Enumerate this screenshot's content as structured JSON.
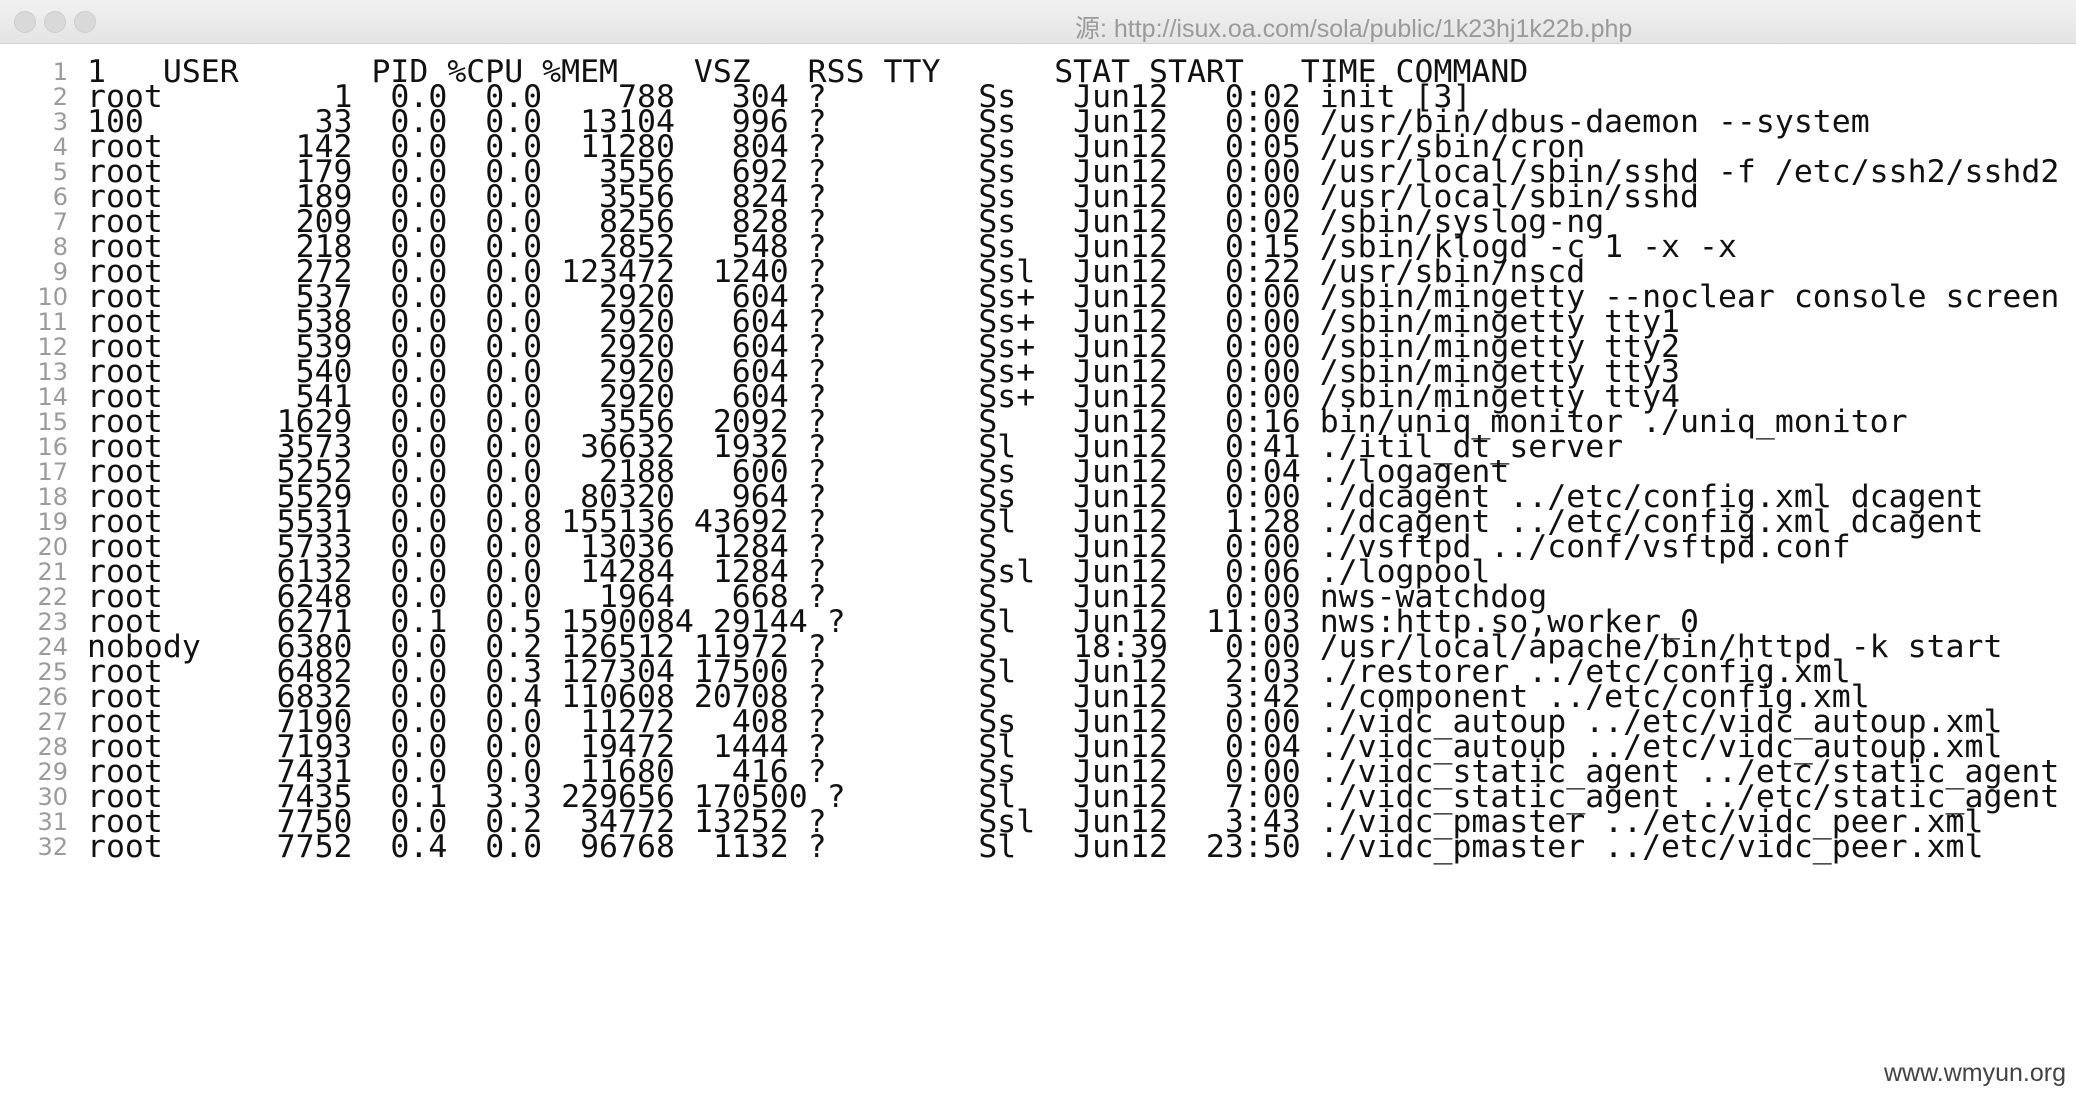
{
  "window": {
    "title": "源: http://isux.oa.com/sola/public/1k23hj1k22b.php"
  },
  "lines": [
    "1   USER       PID %CPU %MEM    VSZ   RSS TTY      STAT START   TIME COMMAND",
    "root         1  0.0  0.0    788   304 ?        Ss   Jun12   0:02 init [3]",
    "100         33  0.0  0.0  13104   996 ?        Ss   Jun12   0:00 /usr/bin/dbus-daemon --system",
    "root       142  0.0  0.0  11280   804 ?        Ss   Jun12   0:05 /usr/sbin/cron",
    "root       179  0.0  0.0   3556   692 ?        Ss   Jun12   0:00 /usr/local/sbin/sshd -f /etc/ssh2/sshd2",
    "root       189  0.0  0.0   3556   824 ?        Ss   Jun12   0:00 /usr/local/sbin/sshd",
    "root       209  0.0  0.0   8256   828 ?        Ss   Jun12   0:02 /sbin/syslog-ng",
    "root       218  0.0  0.0   2852   548 ?        Ss   Jun12   0:15 /sbin/klogd -c 1 -x -x",
    "root       272  0.0  0.0 123472  1240 ?        Ssl  Jun12   0:22 /usr/sbin/nscd",
    "root       537  0.0  0.0   2920   604 ?        Ss+  Jun12   0:00 /sbin/mingetty --noclear console screen",
    "root       538  0.0  0.0   2920   604 ?        Ss+  Jun12   0:00 /sbin/mingetty tty1",
    "root       539  0.0  0.0   2920   604 ?        Ss+  Jun12   0:00 /sbin/mingetty tty2",
    "root       540  0.0  0.0   2920   604 ?        Ss+  Jun12   0:00 /sbin/mingetty tty3",
    "root       541  0.0  0.0   2920   604 ?        Ss+  Jun12   0:00 /sbin/mingetty tty4",
    "root      1629  0.0  0.0   3556  2092 ?        S    Jun12   0:16 bin/uniq_monitor ./uniq_monitor",
    "root      3573  0.0  0.0  36632  1932 ?        Sl   Jun12   0:41 ./itil_dt_server",
    "root      5252  0.0  0.0   2188   600 ?        Ss   Jun12   0:04 ./logagent",
    "root      5529  0.0  0.0  80320   964 ?        Ss   Jun12   0:00 ./dcagent ../etc/config.xml dcagent",
    "root      5531  0.0  0.8 155136 43692 ?        Sl   Jun12   1:28 ./dcagent ../etc/config.xml dcagent",
    "root      5733  0.0  0.0  13036  1284 ?        S    Jun12   0:00 ./vsftpd ../conf/vsftpd.conf",
    "root      6132  0.0  0.0  14284  1284 ?        Ssl  Jun12   0:06 ./logpool",
    "root      6248  0.0  0.0   1964   668 ?        S    Jun12   0:00 nws-watchdog",
    "root      6271  0.1  0.5 1590084 29144 ?       Sl   Jun12  11:03 nws:http.so,worker_0",
    "nobody    6380  0.0  0.2 126512 11972 ?        S    18:39   0:00 /usr/local/apache/bin/httpd -k start",
    "root      6482  0.0  0.3 127304 17500 ?        Sl   Jun12   2:03 ./restorer ../etc/config.xml",
    "root      6832  0.0  0.4 110608 20708 ?        S    Jun12   3:42 ./component ../etc/config.xml",
    "root      7190  0.0  0.0  11272   408 ?        Ss   Jun12   0:00 ./vidc_autoup ../etc/vidc_autoup.xml",
    "root      7193  0.0  0.0  19472  1444 ?        Sl   Jun12   0:04 ./vidc_autoup ../etc/vidc_autoup.xml",
    "root      7431  0.0  0.0  11680   416 ?        Ss   Jun12   0:00 ./vidc_static_agent ../etc/static_agent",
    "root      7435  0.1  3.3 229656 170500 ?       Sl   Jun12   7:00 ./vidc_static_agent ../etc/static_agent",
    "root      7750  0.0  0.2  34772 13252 ?        Ssl  Jun12   3:43 ./vidc_pmaster ../etc/vidc_peer.xml",
    "root      7752  0.4  0.0  96768  1132 ?        Sl   Jun12  23:50 ./vidc_pmaster ../etc/vidc_peer.xml"
  ],
  "watermark": "www.wmyun.org"
}
